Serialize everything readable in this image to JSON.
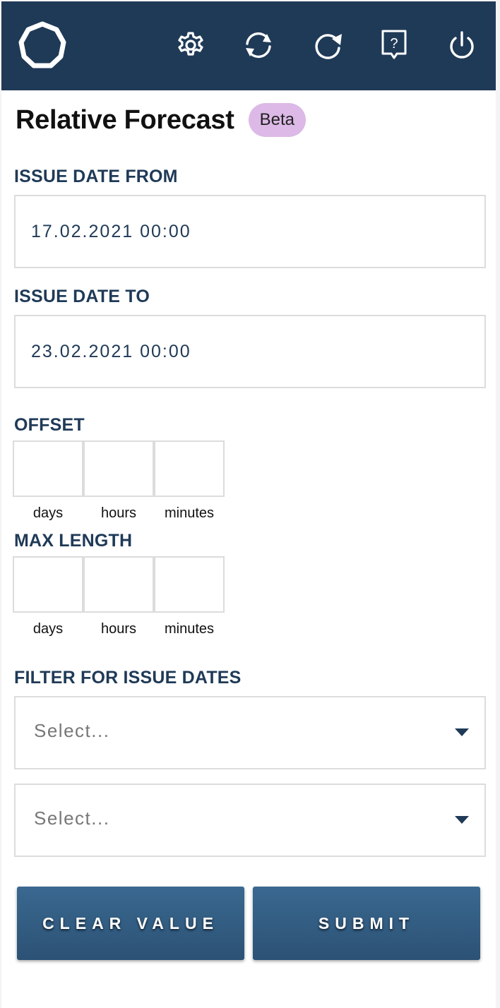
{
  "header": {
    "icons": [
      "logo-octagon-icon",
      "gear-icon",
      "sync-icon",
      "refresh-icon",
      "help-icon",
      "power-icon"
    ],
    "colors": {
      "background": "#1f3a57",
      "icon": "#ffffff"
    }
  },
  "page": {
    "title": "Relative Forecast",
    "badge": "Beta",
    "badge_color": "#dcb9e6"
  },
  "issue_date_from": {
    "label": "ISSUE DATE FROM",
    "value": "17.02.2021 00:00"
  },
  "issue_date_to": {
    "label": "ISSUE DATE TO",
    "value": "23.02.2021 00:00"
  },
  "offset": {
    "label": "OFFSET",
    "days": "",
    "hours": "",
    "minutes": "",
    "units": [
      "days",
      "hours",
      "minutes"
    ]
  },
  "max_length": {
    "label": "MAX LENGTH",
    "days": "",
    "hours": "",
    "minutes": "",
    "units": [
      "days",
      "hours",
      "minutes"
    ]
  },
  "filter": {
    "label": "FILTER FOR ISSUE DATES",
    "selects": [
      {
        "placeholder": "Select..."
      },
      {
        "placeholder": "Select..."
      }
    ]
  },
  "buttons": {
    "clear": "CLEAR VALUE",
    "submit": "SUBMIT",
    "color": "#2f5a80"
  }
}
